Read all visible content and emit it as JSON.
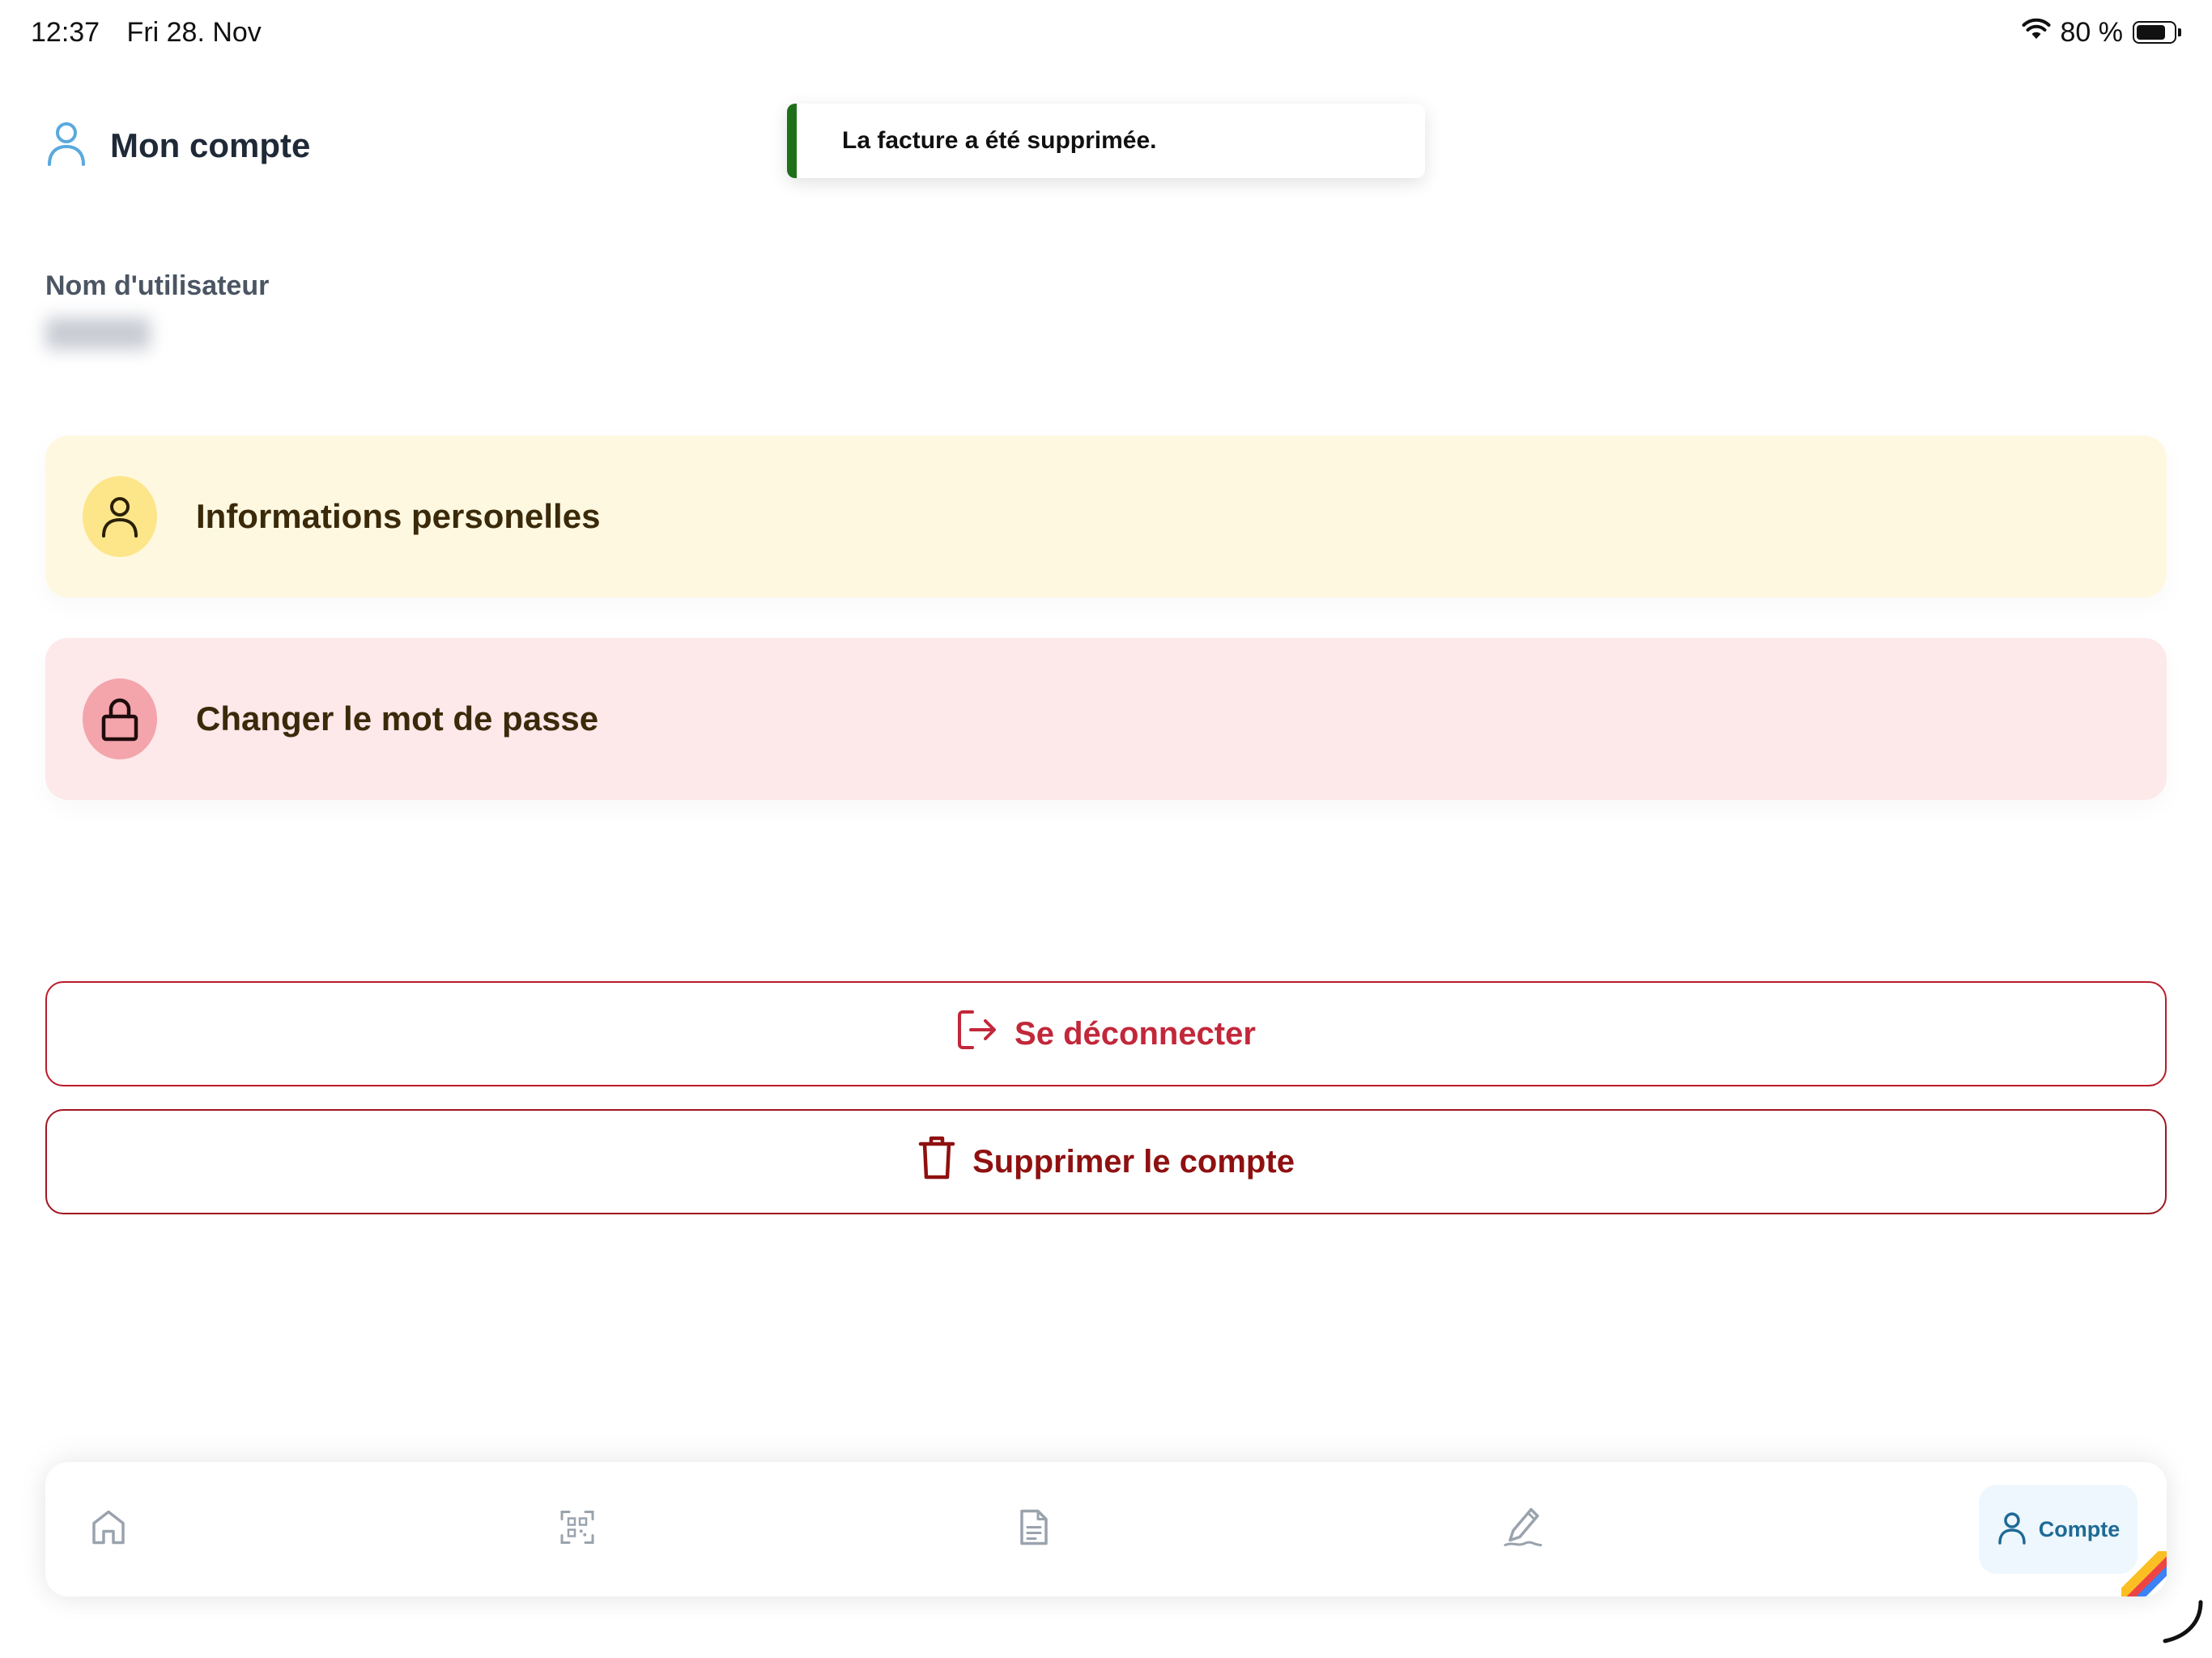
{
  "status_bar": {
    "time": "12:37",
    "date": "Fri 28. Nov",
    "battery_text": "80 %",
    "battery_level": 0.8
  },
  "header": {
    "icon": "user-icon",
    "title": "Mon compte"
  },
  "toast": {
    "message": "La facture a été supprimée.",
    "accent_color": "#1f6f1a"
  },
  "account": {
    "username_label": "Nom d'utilisateur"
  },
  "cards": {
    "personal_info": {
      "icon": "user-icon",
      "label": "Informations personelles",
      "background": "#fff8e1"
    },
    "change_password": {
      "icon": "lock-icon",
      "label": "Changer le mot de passe",
      "background": "#fde8ea"
    }
  },
  "actions": {
    "logout": {
      "icon": "logout-icon",
      "label": "Se déconnecter",
      "color": "#c2273a"
    },
    "delete_account": {
      "icon": "trash-icon",
      "label": "Supprimer le compte",
      "color": "#8f1010"
    }
  },
  "bottom_nav": {
    "items": [
      {
        "icon": "home-icon"
      },
      {
        "icon": "qr-scan-icon"
      },
      {
        "icon": "document-icon"
      },
      {
        "icon": "signature-icon"
      },
      {
        "icon": "user-icon",
        "label": "Compte",
        "active": true
      }
    ]
  }
}
